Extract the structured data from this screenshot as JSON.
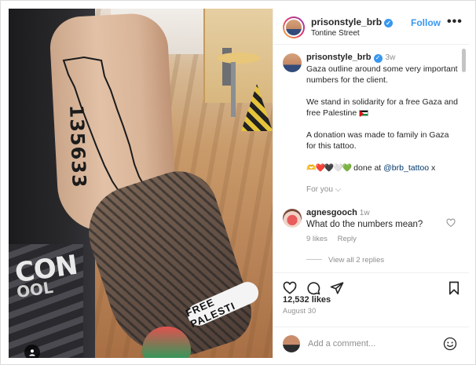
{
  "post": {
    "username": "prisonstyle_brb",
    "location": "Tontine Street",
    "follow_label": "Follow",
    "more_label": "•••",
    "verified_glyph": "✓",
    "image": {
      "tattoo_number": "135633",
      "bracelet_text": "FREE PALESTI",
      "leg_text_1": "CON",
      "leg_text_2": "OOL"
    },
    "caption": {
      "username": "prisonstyle_brb",
      "time": "3w",
      "line1": "Gaza outline around some very important numbers for the client.",
      "line2": "We stand in solidarity for a free Gaza and free Palestine",
      "line3": "A donation was made to  family in Gaza for this tattoo.",
      "hearts": "🫶❤️🖤🤍💚",
      "line4_prefix": " done at ",
      "mention": "@brb_tattoo",
      "line4_suffix": " x"
    },
    "for_you": "For you ⌵",
    "comment": {
      "username": "agnesgooch",
      "time": "1w",
      "text": "What do the numbers mean?",
      "likes": "9 likes",
      "reply": "Reply"
    },
    "view_replies": "View all 2 replies",
    "likes_count": "12,532 likes",
    "date": "August 30",
    "add_comment_placeholder": "Add a comment..."
  },
  "icons": [
    "heart-icon",
    "comment-icon",
    "share-icon",
    "bookmark-icon",
    "emoji-icon",
    "user-tag-icon",
    "verified-icon"
  ],
  "colors": {
    "link_blue": "#3897f0",
    "text": "#262626",
    "muted": "#8e8e8e",
    "mention": "#00376b"
  }
}
